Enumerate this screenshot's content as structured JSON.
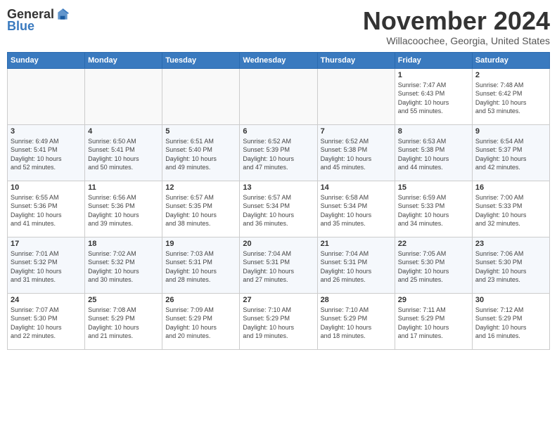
{
  "header": {
    "logo_general": "General",
    "logo_blue": "Blue",
    "month_title": "November 2024",
    "location": "Willacoochee, Georgia, United States"
  },
  "weekdays": [
    "Sunday",
    "Monday",
    "Tuesday",
    "Wednesday",
    "Thursday",
    "Friday",
    "Saturday"
  ],
  "weeks": [
    [
      {
        "day": "",
        "info": ""
      },
      {
        "day": "",
        "info": ""
      },
      {
        "day": "",
        "info": ""
      },
      {
        "day": "",
        "info": ""
      },
      {
        "day": "",
        "info": ""
      },
      {
        "day": "1",
        "info": "Sunrise: 7:47 AM\nSunset: 6:43 PM\nDaylight: 10 hours\nand 55 minutes."
      },
      {
        "day": "2",
        "info": "Sunrise: 7:48 AM\nSunset: 6:42 PM\nDaylight: 10 hours\nand 53 minutes."
      }
    ],
    [
      {
        "day": "3",
        "info": "Sunrise: 6:49 AM\nSunset: 5:41 PM\nDaylight: 10 hours\nand 52 minutes."
      },
      {
        "day": "4",
        "info": "Sunrise: 6:50 AM\nSunset: 5:41 PM\nDaylight: 10 hours\nand 50 minutes."
      },
      {
        "day": "5",
        "info": "Sunrise: 6:51 AM\nSunset: 5:40 PM\nDaylight: 10 hours\nand 49 minutes."
      },
      {
        "day": "6",
        "info": "Sunrise: 6:52 AM\nSunset: 5:39 PM\nDaylight: 10 hours\nand 47 minutes."
      },
      {
        "day": "7",
        "info": "Sunrise: 6:52 AM\nSunset: 5:38 PM\nDaylight: 10 hours\nand 45 minutes."
      },
      {
        "day": "8",
        "info": "Sunrise: 6:53 AM\nSunset: 5:38 PM\nDaylight: 10 hours\nand 44 minutes."
      },
      {
        "day": "9",
        "info": "Sunrise: 6:54 AM\nSunset: 5:37 PM\nDaylight: 10 hours\nand 42 minutes."
      }
    ],
    [
      {
        "day": "10",
        "info": "Sunrise: 6:55 AM\nSunset: 5:36 PM\nDaylight: 10 hours\nand 41 minutes."
      },
      {
        "day": "11",
        "info": "Sunrise: 6:56 AM\nSunset: 5:36 PM\nDaylight: 10 hours\nand 39 minutes."
      },
      {
        "day": "12",
        "info": "Sunrise: 6:57 AM\nSunset: 5:35 PM\nDaylight: 10 hours\nand 38 minutes."
      },
      {
        "day": "13",
        "info": "Sunrise: 6:57 AM\nSunset: 5:34 PM\nDaylight: 10 hours\nand 36 minutes."
      },
      {
        "day": "14",
        "info": "Sunrise: 6:58 AM\nSunset: 5:34 PM\nDaylight: 10 hours\nand 35 minutes."
      },
      {
        "day": "15",
        "info": "Sunrise: 6:59 AM\nSunset: 5:33 PM\nDaylight: 10 hours\nand 34 minutes."
      },
      {
        "day": "16",
        "info": "Sunrise: 7:00 AM\nSunset: 5:33 PM\nDaylight: 10 hours\nand 32 minutes."
      }
    ],
    [
      {
        "day": "17",
        "info": "Sunrise: 7:01 AM\nSunset: 5:32 PM\nDaylight: 10 hours\nand 31 minutes."
      },
      {
        "day": "18",
        "info": "Sunrise: 7:02 AM\nSunset: 5:32 PM\nDaylight: 10 hours\nand 30 minutes."
      },
      {
        "day": "19",
        "info": "Sunrise: 7:03 AM\nSunset: 5:31 PM\nDaylight: 10 hours\nand 28 minutes."
      },
      {
        "day": "20",
        "info": "Sunrise: 7:04 AM\nSunset: 5:31 PM\nDaylight: 10 hours\nand 27 minutes."
      },
      {
        "day": "21",
        "info": "Sunrise: 7:04 AM\nSunset: 5:31 PM\nDaylight: 10 hours\nand 26 minutes."
      },
      {
        "day": "22",
        "info": "Sunrise: 7:05 AM\nSunset: 5:30 PM\nDaylight: 10 hours\nand 25 minutes."
      },
      {
        "day": "23",
        "info": "Sunrise: 7:06 AM\nSunset: 5:30 PM\nDaylight: 10 hours\nand 23 minutes."
      }
    ],
    [
      {
        "day": "24",
        "info": "Sunrise: 7:07 AM\nSunset: 5:30 PM\nDaylight: 10 hours\nand 22 minutes."
      },
      {
        "day": "25",
        "info": "Sunrise: 7:08 AM\nSunset: 5:29 PM\nDaylight: 10 hours\nand 21 minutes."
      },
      {
        "day": "26",
        "info": "Sunrise: 7:09 AM\nSunset: 5:29 PM\nDaylight: 10 hours\nand 20 minutes."
      },
      {
        "day": "27",
        "info": "Sunrise: 7:10 AM\nSunset: 5:29 PM\nDaylight: 10 hours\nand 19 minutes."
      },
      {
        "day": "28",
        "info": "Sunrise: 7:10 AM\nSunset: 5:29 PM\nDaylight: 10 hours\nand 18 minutes."
      },
      {
        "day": "29",
        "info": "Sunrise: 7:11 AM\nSunset: 5:29 PM\nDaylight: 10 hours\nand 17 minutes."
      },
      {
        "day": "30",
        "info": "Sunrise: 7:12 AM\nSunset: 5:29 PM\nDaylight: 10 hours\nand 16 minutes."
      }
    ]
  ]
}
